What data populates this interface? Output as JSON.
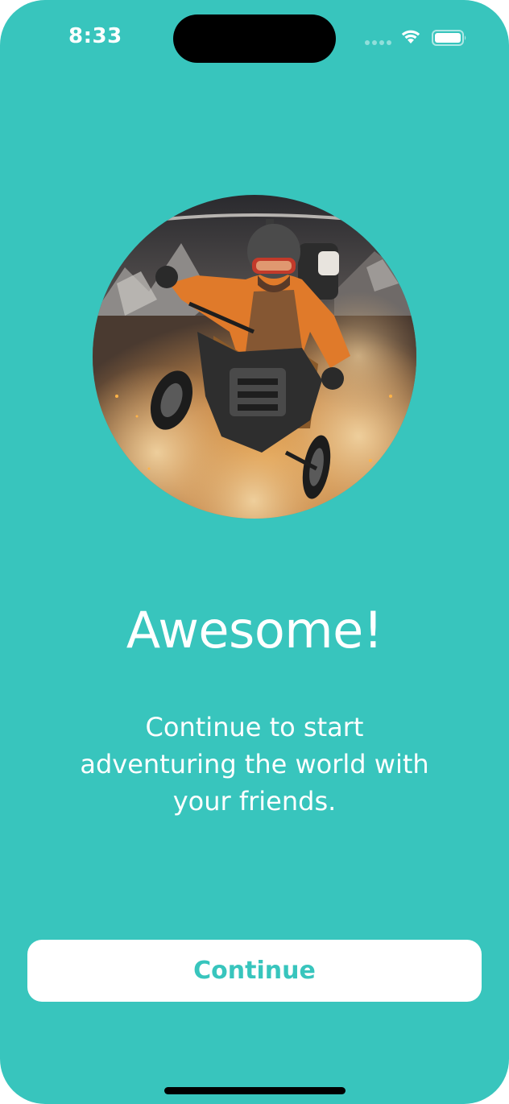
{
  "status_bar": {
    "time": "8:33",
    "icons": [
      "signal-icon",
      "wifi-icon",
      "battery-icon"
    ]
  },
  "hero": {
    "icon": "adventure-rider-photo"
  },
  "content": {
    "title": "Awesome!",
    "subtitle": "Continue to start adventuring the world with your friends."
  },
  "actions": {
    "continue_label": "Continue"
  },
  "colors": {
    "background": "#38c5bd",
    "button_background": "#ffffff",
    "button_text": "#38c5bd",
    "text": "#ffffff"
  }
}
